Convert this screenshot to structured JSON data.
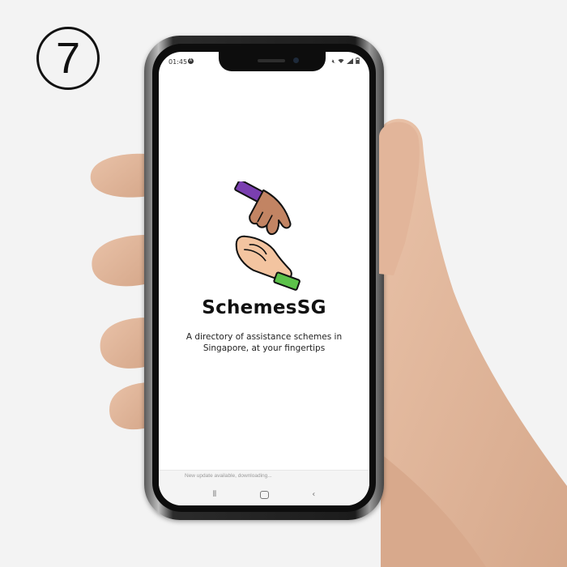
{
  "step": {
    "number": "7"
  },
  "status_bar": {
    "time": "01:45",
    "left_icon": "A",
    "right_icons": [
      "mute-icon",
      "wifi-icon",
      "signal-icon",
      "battery-icon"
    ]
  },
  "app": {
    "title": "SchemesSG",
    "tagline": "A directory of assistance schemes in Singapore, at your fingertips",
    "logo_icon": "helping-hands-logo"
  },
  "update_banner": {
    "text": "New update available, downloading..."
  },
  "nav": {
    "recents_glyph": "⦀",
    "back_glyph": "‹"
  },
  "colors": {
    "sleeve_top": "#7a3fb0",
    "sleeve_bottom": "#5cc24a",
    "skin_dark": "#c28463",
    "skin_light": "#f3c4a0"
  }
}
